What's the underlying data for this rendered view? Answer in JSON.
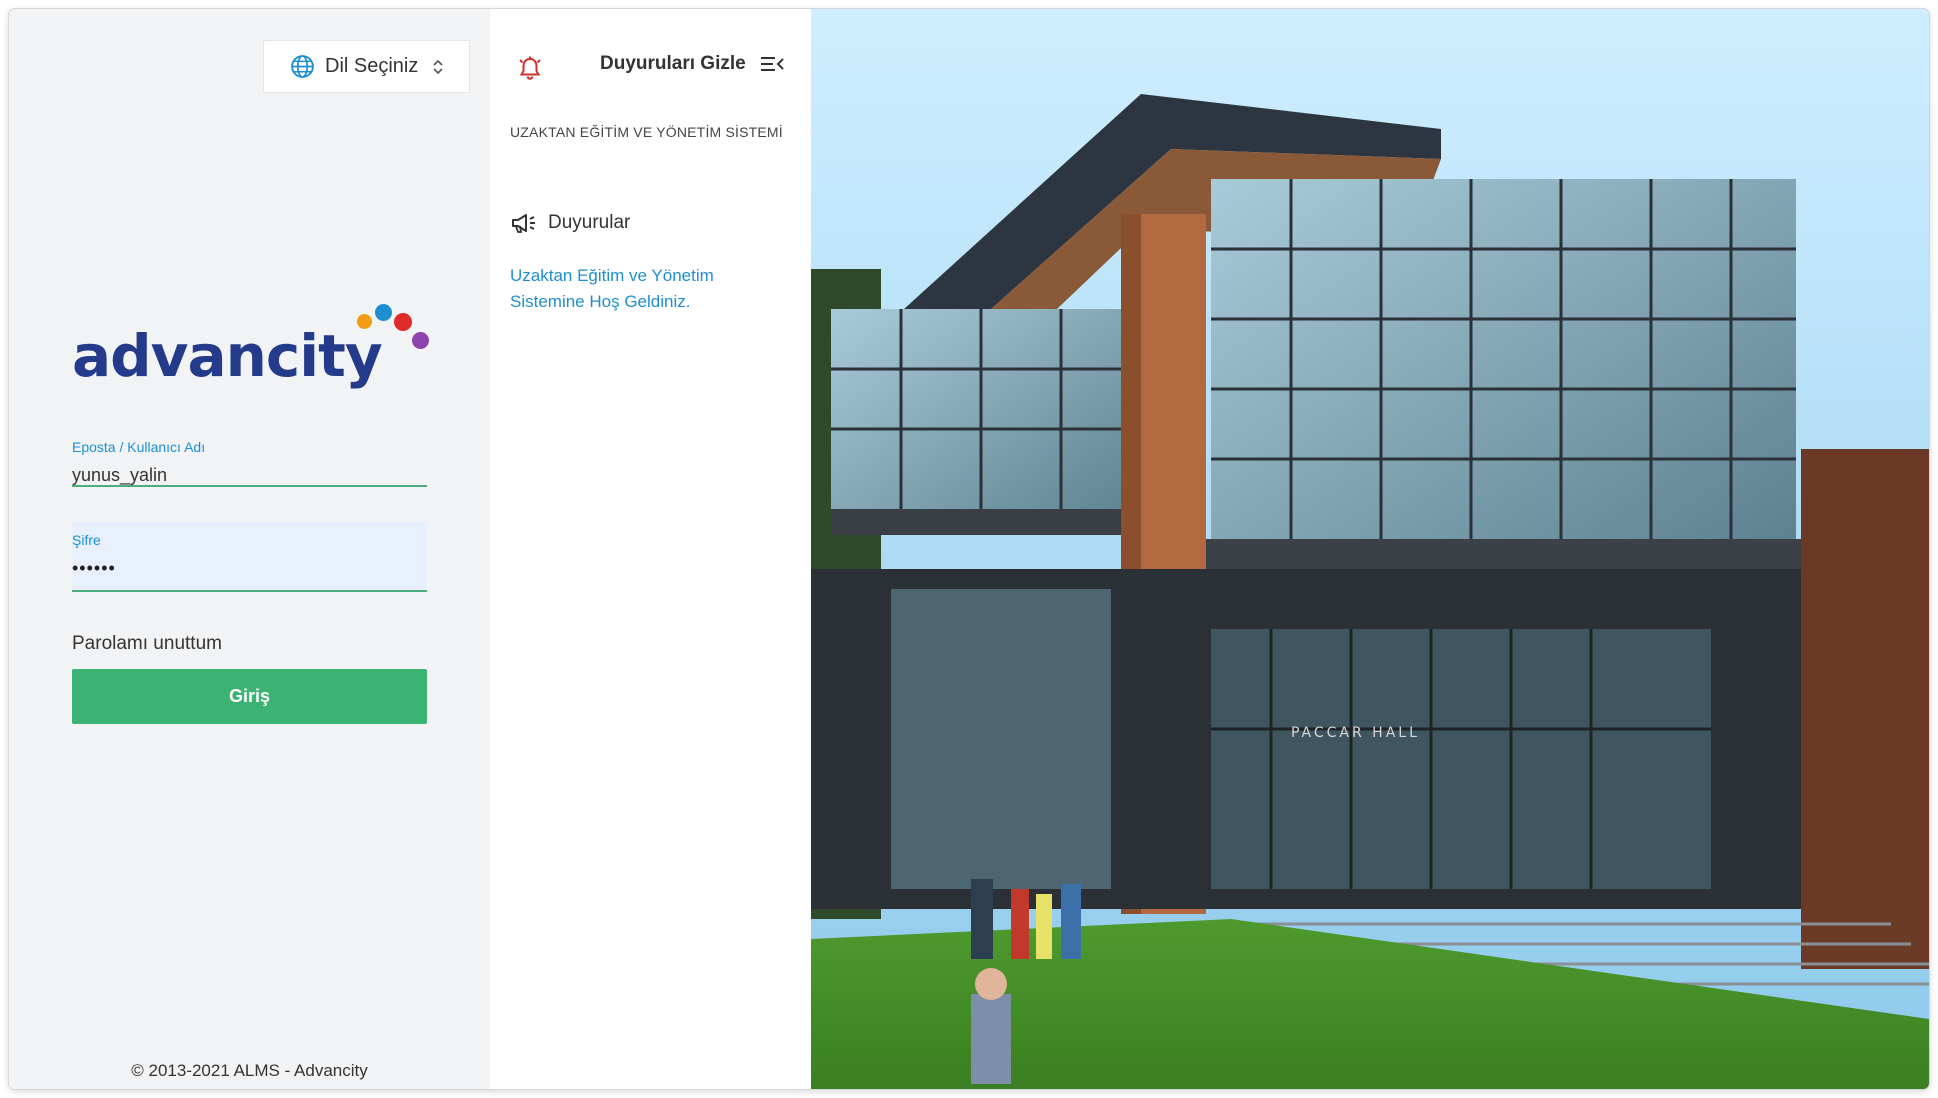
{
  "language_selector": {
    "label": "Dil Seçiniz"
  },
  "logo": {
    "text": "advancity",
    "colors": [
      "#243a8a",
      "#f39c12",
      "#1d8fd0",
      "#e02b2b",
      "#8e44ad"
    ]
  },
  "login": {
    "username_label": "Eposta / Kullanıcı Adı",
    "username_value": "yunus_yalin",
    "password_label": "Şifre",
    "password_value": "••••••",
    "forgot_password": "Parolamı unuttum",
    "submit_label": "Giriş"
  },
  "footer": {
    "copyright": "© 2013-2021 ALMS - Advancity"
  },
  "announcements": {
    "toggle_label": "Duyuruları Gizle",
    "system_title": "UZAKTAN EĞİTİM VE YÖNETİM SİSTEMİ",
    "heading": "Duyurular",
    "items": [
      {
        "text": "Uzaktan Eğitim ve Yönetim Sistemine Hoş Geldiniz."
      }
    ]
  },
  "photo": {
    "building_sign": "PACCAR HALL"
  },
  "colors": {
    "accent_blue": "#1d8fd0",
    "button_green": "#3cb273",
    "brand_navy": "#243a8a",
    "bell_red": "#d0312d"
  }
}
